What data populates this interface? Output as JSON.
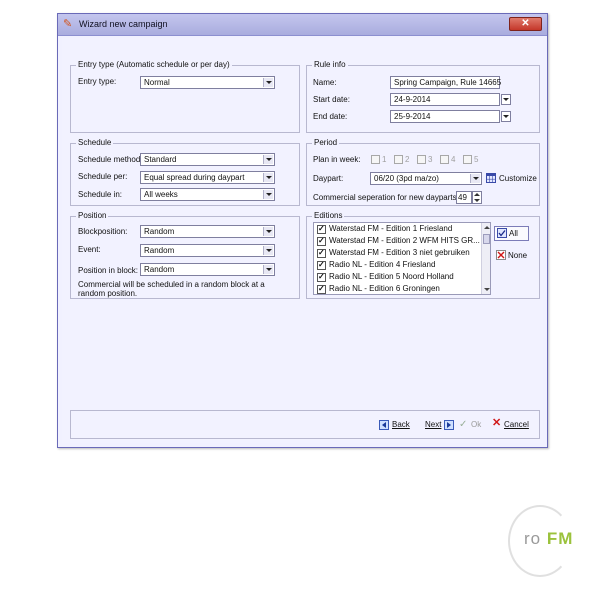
{
  "window": {
    "title": "Wizard new campaign",
    "close_label": "✕"
  },
  "entry_type": {
    "group_title": "Entry type (Automatic schedule or per day)",
    "label": "Entry type:",
    "value": "Normal"
  },
  "rule_info": {
    "group_title": "Rule info",
    "name_label": "Name:",
    "name_value": "Spring Campaign, Rule 14665",
    "start_label": "Start date:",
    "start_value": "24-9-2014",
    "end_label": "End date:",
    "end_value": "25-9-2014"
  },
  "schedule": {
    "group_title": "Schedule",
    "method_label": "Schedule method:",
    "method_value": "Standard",
    "per_label": "Schedule per:",
    "per_value": "Equal spread during daypart",
    "in_label": "Schedule in:",
    "in_value": "All weeks"
  },
  "period": {
    "group_title": "Period",
    "plan_label": "Plan in week:",
    "weeks": [
      "1",
      "2",
      "3",
      "4",
      "5"
    ],
    "daypart_label": "Daypart:",
    "daypart_value": "06/20 (3pd ma/zo)",
    "customize_label": "Customize",
    "separation_label": "Commercial seperation for new dayparts:",
    "separation_value": "49"
  },
  "position": {
    "group_title": "Position",
    "block_label": "Blockposition:",
    "block_value": "Random",
    "event_label": "Event:",
    "event_value": "Random",
    "pos_label": "Position in block:",
    "pos_value": "Random",
    "note": "Commercial will be scheduled in a random block at a random position."
  },
  "editions": {
    "group_title": "Editions",
    "items": [
      {
        "label": "Waterstad FM - Edition 1 Friesland",
        "checked": true
      },
      {
        "label": "Waterstad FM - Edition 2 WFM HITS GR...",
        "checked": true
      },
      {
        "label": "Waterstad FM - Edition 3 niet gebruiken",
        "checked": true
      },
      {
        "label": "Radio NL - Edition 4 Friesland",
        "checked": true
      },
      {
        "label": "Radio NL - Edition 5 Noord Holland",
        "checked": true
      },
      {
        "label": "Radio NL - Edition 6 Groningen",
        "checked": true
      }
    ],
    "all_label": "All",
    "none_label": "None"
  },
  "footer": {
    "back_label": "Back",
    "next_label": "Next",
    "ok_label": "Ok",
    "cancel_label": "Cancel"
  },
  "watermark": {
    "pro": "roFM"
  },
  "colors": {
    "window_bg": "#f2f2ff",
    "title_bar": "#b0b3e2",
    "close": "#c4372a",
    "cancel_x": "#d01818",
    "watermark_fm": "#9bc23c"
  }
}
